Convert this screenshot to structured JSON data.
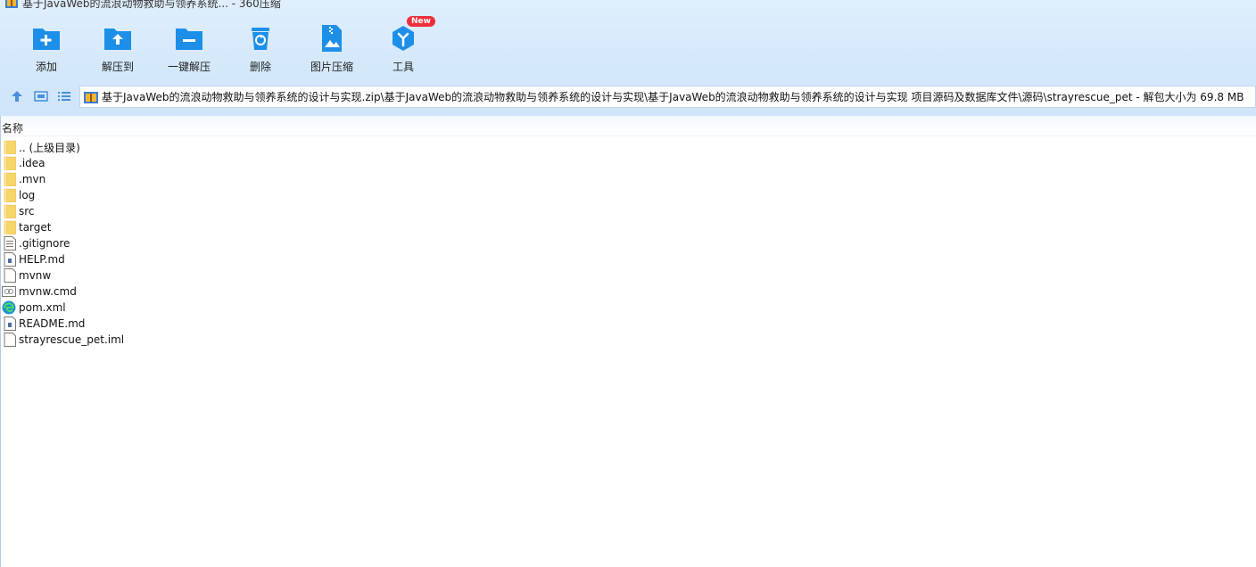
{
  "window": {
    "title": "基于JavaWeb的流浪动物救助与领养系统... - 360压缩"
  },
  "toolbar": [
    {
      "label": "添加",
      "icon": "add-icon"
    },
    {
      "label": "解压到",
      "icon": "extract-to-icon"
    },
    {
      "label": "一键解压",
      "icon": "one-click-extract-icon"
    },
    {
      "label": "删除",
      "icon": "delete-icon"
    },
    {
      "label": "图片压缩",
      "icon": "image-compress-icon"
    },
    {
      "label": "工具",
      "icon": "tools-icon",
      "badge": "New"
    }
  ],
  "address": {
    "path": "基于JavaWeb的流浪动物救助与领养系统的设计与实现.zip\\基于JavaWeb的流浪动物救助与领养系统的设计与实现\\基于JavaWeb的流浪动物救助与领养系统的设计与实现 项目源码及数据库文件\\源码\\strayrescue_pet - 解包大小为 69.8 MB"
  },
  "columns": {
    "name": "名称"
  },
  "files": [
    {
      "name": ".. (上级目录)",
      "type": "folder"
    },
    {
      "name": ".idea",
      "type": "folder"
    },
    {
      "name": ".mvn",
      "type": "folder"
    },
    {
      "name": "log",
      "type": "folder"
    },
    {
      "name": "src",
      "type": "folder"
    },
    {
      "name": "target",
      "type": "folder"
    },
    {
      "name": ".gitignore",
      "type": "text"
    },
    {
      "name": "HELP.md",
      "type": "md"
    },
    {
      "name": "mvnw",
      "type": "blank"
    },
    {
      "name": "mvnw.cmd",
      "type": "cmd"
    },
    {
      "name": "pom.xml",
      "type": "edge"
    },
    {
      "name": "README.md",
      "type": "md"
    },
    {
      "name": "strayrescue_pet.iml",
      "type": "blank"
    }
  ],
  "colors": {
    "accent": "#1e8fe8",
    "folder": "#f6d56b",
    "badge": "#ee2f3a"
  }
}
